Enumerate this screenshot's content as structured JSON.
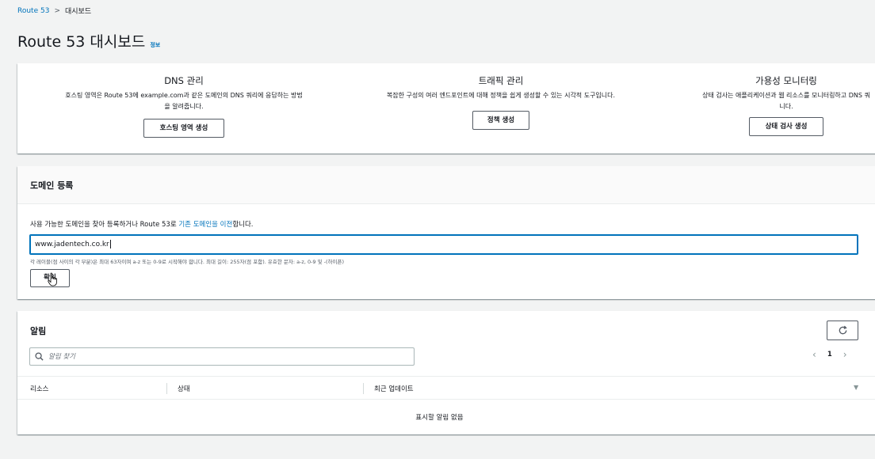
{
  "breadcrumb": {
    "root": "Route 53",
    "separator": ">",
    "current": "대시보드"
  },
  "page": {
    "title": "Route 53 대시보드",
    "info": "정보"
  },
  "features": {
    "dns": {
      "title": "DNS 관리",
      "desc_line1": "호스팅 영역은 Route 53에 example.com과 같은 도메인의 DNS 쿼리에 응답하는 방법",
      "desc_line2": "을 알려줍니다.",
      "button": "호스팅 영역 생성"
    },
    "traffic": {
      "title": "트래픽 관리",
      "desc": "복잡한 구성의 여러 엔드포인트에 대해 정책을 쉽게 생성할 수 있는 시각적 도구입니다.",
      "button": "정책 생성"
    },
    "availability": {
      "title": "가용성 모니터링",
      "desc_line1": "상태 검사는 애플리케이션과 웹 리소스를 모니터링하고 DNS 쿼",
      "desc_line2": "니다.",
      "button": "상태 검사 생성"
    }
  },
  "domain": {
    "heading": "도메인 등록",
    "desc_prefix": "사용 가능한 도메인을 찾아 등록하거나 Route 53로 ",
    "desc_link": "기존 도메인을 이전",
    "desc_suffix": "합니다.",
    "input_value": "www.jadentech.co.kr",
    "hint": "각 레이블(점 사이의 각 부분)은 최대 63자이며 a-z 또는 0-9로 시작해야 합니다. 최대 길이: 255자(점 포함). 유효한 문자: a-z, 0-9 및 -(하이픈)",
    "confirm_button": "확인"
  },
  "alerts": {
    "heading": "알림",
    "search_placeholder": "알림 찾기",
    "page": "1",
    "columns": {
      "resource": "리소스",
      "status": "상태",
      "updated": "최근 업데이트"
    },
    "empty": "표시할 알림 없음"
  },
  "colors": {
    "accent": "#0073bb",
    "background": "#f2f3f3",
    "text": "#16191f"
  }
}
